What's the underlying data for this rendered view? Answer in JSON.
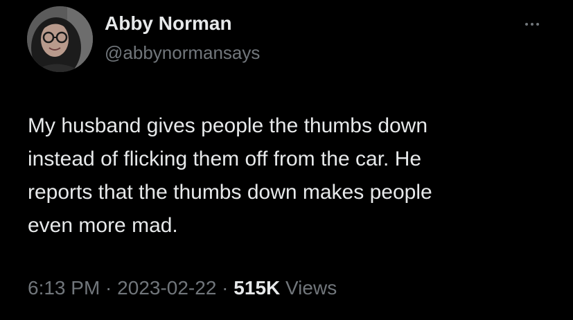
{
  "author": {
    "name": "Abby Norman",
    "handle": "@abbynormansays"
  },
  "tweet": {
    "lines": [
      "My husband gives people the thumbs down",
      "instead of flicking them off from the car. He",
      "reports that the thumbs down makes people",
      "even more mad."
    ]
  },
  "meta": {
    "time": "6:13 PM",
    "separator": " · ",
    "date": "2023-02-22",
    "views_count": "515K",
    "views_label": "Views"
  },
  "icons": {
    "more": "more-horizontal-icon"
  },
  "colors": {
    "background": "#000000",
    "primary_text": "#e7e9ea",
    "secondary_text": "#71767b"
  }
}
